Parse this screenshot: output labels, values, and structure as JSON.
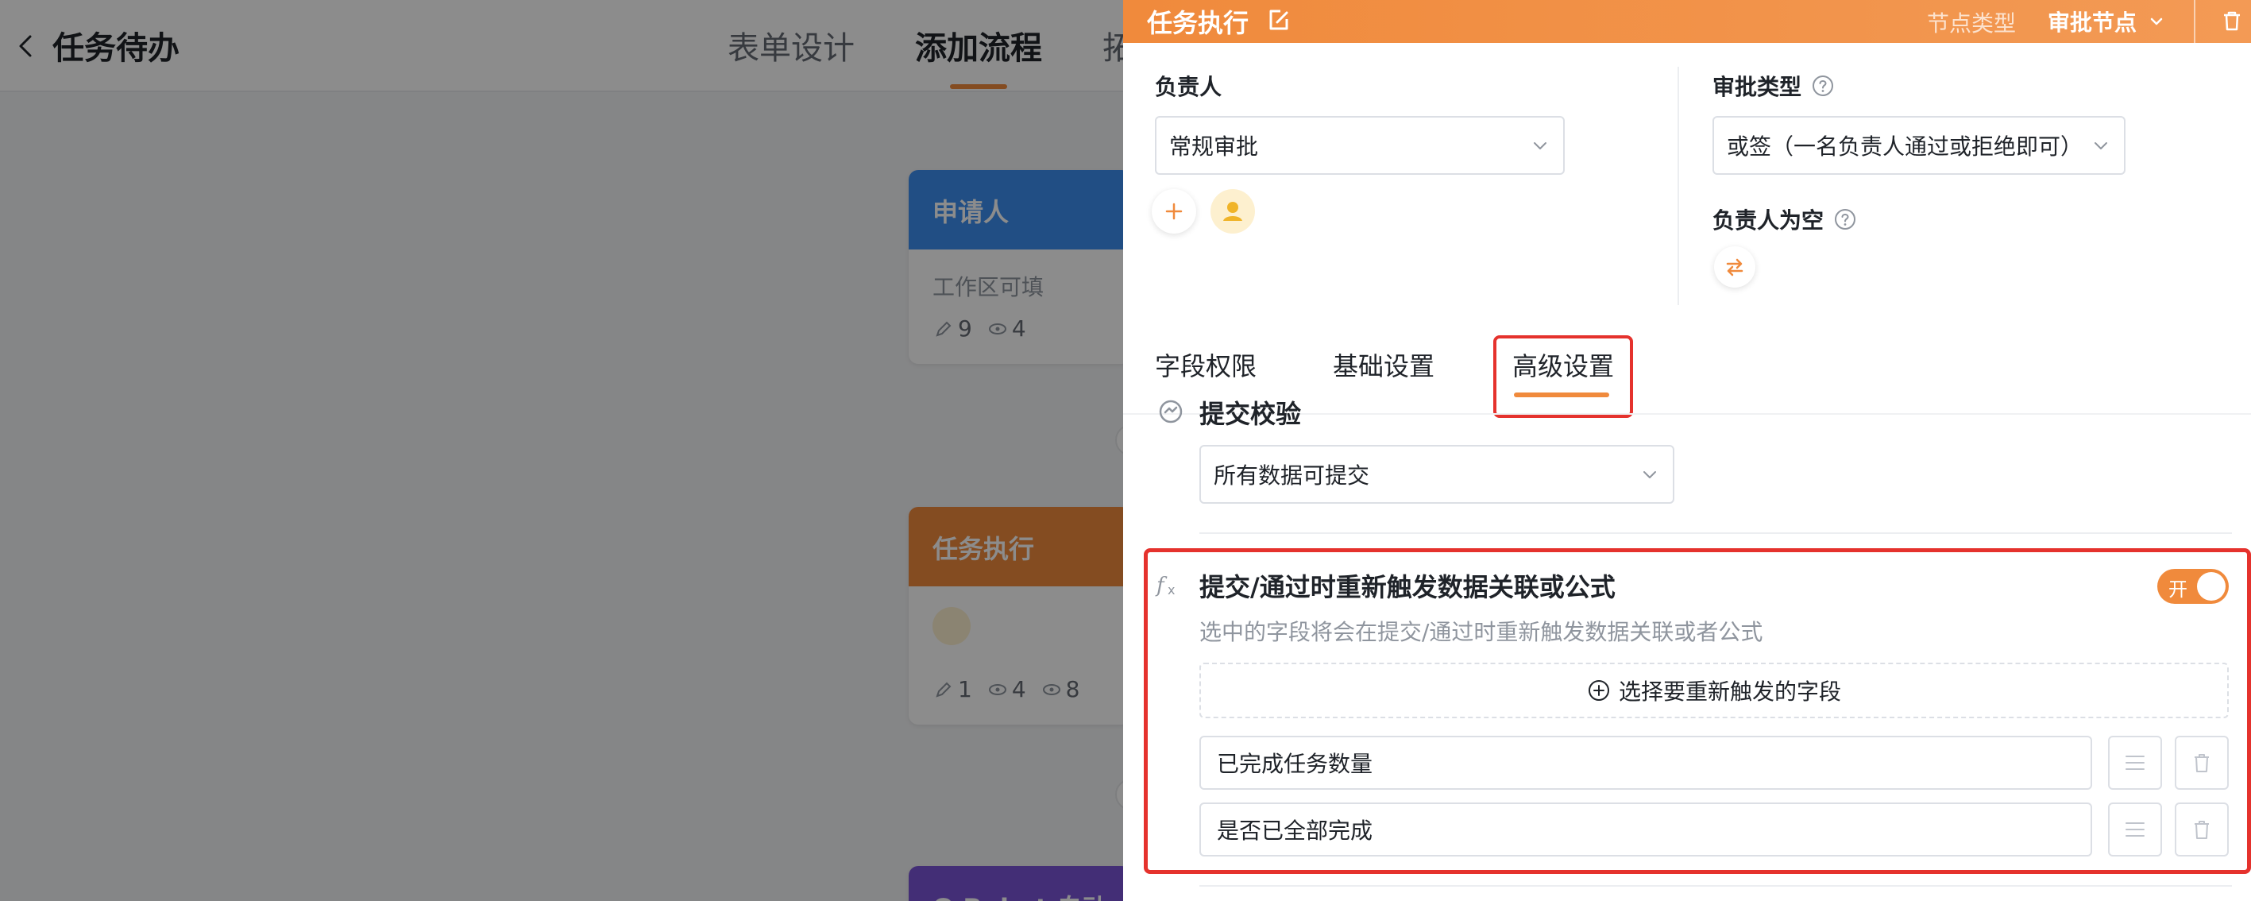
{
  "app": {
    "page_title": "任务待办",
    "tabs": [
      {
        "label": "表单设计"
      },
      {
        "label": "添加流程"
      },
      {
        "label": "拓"
      }
    ],
    "nodes": {
      "applicant": {
        "title": "申请人",
        "subtitle": "工作区可填",
        "edit_count": "9",
        "view_count": "4"
      },
      "task": {
        "title": "任务执行",
        "edit_count": "1",
        "view_count": "4",
        "hidden_count": "8"
      },
      "bot": {
        "title": "Q Robot 自动"
      }
    }
  },
  "drawer": {
    "title": "任务执行",
    "node_type_label": "节点类型",
    "node_type_value": "审批节点",
    "assignee": {
      "label": "负责人",
      "value": "常规审批"
    },
    "approval_type": {
      "label": "审批类型",
      "value": "或签（一名负责人通过或拒绝即可）"
    },
    "empty_assignee": {
      "label": "负责人为空"
    },
    "tabs": [
      {
        "label": "字段权限"
      },
      {
        "label": "基础设置"
      },
      {
        "label": "高级设置"
      }
    ],
    "submit_check": {
      "title": "提交校验",
      "value": "所有数据可提交"
    },
    "retrigger": {
      "title": "提交/通过时重新触发数据关联或公式",
      "description": "选中的字段将会在提交/通过时重新触发数据关联或者公式",
      "toggle_label": "开",
      "select_button_label": "选择要重新触发的字段",
      "fields": [
        "已完成任务数量",
        "是否已全部完成"
      ]
    }
  },
  "colors": {
    "accent": "#f08a3c",
    "highlight": "#e5322d",
    "applicant_node": "#3d8ef0",
    "bot_node": "#7a55d8"
  }
}
